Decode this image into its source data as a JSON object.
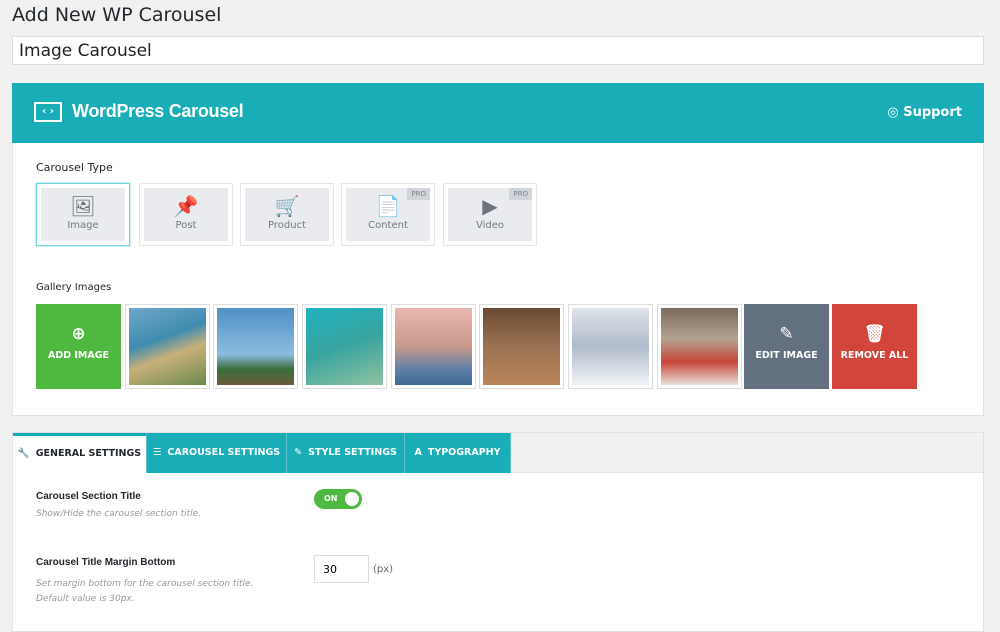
{
  "page": {
    "title": "Add New WP Carousel",
    "carousel_title": "Image Carousel"
  },
  "header": {
    "brand": "WordPress Carousel",
    "support": "Support",
    "logo_glyph": "‹ ›"
  },
  "carousel_type": {
    "label": "Carousel Type",
    "types": [
      {
        "label": "Image",
        "icon": "image-icon",
        "glyph": "🖼",
        "active": true,
        "pro": ""
      },
      {
        "label": "Post",
        "icon": "pushpin-icon",
        "glyph": "📌",
        "active": false,
        "pro": ""
      },
      {
        "label": "Product",
        "icon": "cart-icon",
        "glyph": "🛒",
        "active": false,
        "pro": ""
      },
      {
        "label": "Content",
        "icon": "document-icon",
        "glyph": "📄",
        "active": false,
        "pro": "PRO"
      },
      {
        "label": "Video",
        "icon": "play-icon",
        "glyph": "▶",
        "active": false,
        "pro": "PRO"
      }
    ]
  },
  "gallery": {
    "label": "Gallery Images",
    "add_label": "ADD IMAGE",
    "edit_label": "EDIT IMAGE",
    "remove_label": "REMOVE ALL",
    "colors": {
      "add": "#4fb840",
      "edit": "#627080",
      "remove": "#d1453b"
    },
    "images": [
      "coastline",
      "wind-turbines",
      "sea-turtle",
      "venice-canal",
      "mars-rover",
      "snowy-mountain",
      "strawberries"
    ]
  },
  "tabs": [
    {
      "label": "GENERAL SETTINGS",
      "icon": "wrench-icon",
      "glyph": "🔧"
    },
    {
      "label": "CAROUSEL SETTINGS",
      "icon": "sliders-icon",
      "glyph": "☰"
    },
    {
      "label": "STYLE SETTINGS",
      "icon": "brush-icon",
      "glyph": "✎"
    },
    {
      "label": "TYPOGRAPHY",
      "icon": "font-icon",
      "glyph": "A"
    }
  ],
  "settings": {
    "section_title": {
      "label": "Carousel Section Title",
      "desc": "Show/Hide the carousel section title.",
      "toggle": "ON"
    },
    "margin_bottom": {
      "label": "Carousel Title Margin Bottom",
      "desc1": "Set margin bottom for the carousel section title.",
      "desc2": "Default value is 30px.",
      "value": "30",
      "unit": "(px)"
    }
  },
  "colors": {
    "accent": "#19aeb7"
  }
}
